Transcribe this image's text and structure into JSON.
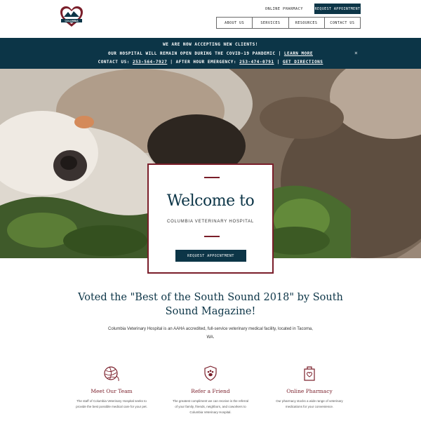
{
  "header": {
    "logo_text": "COLUMBIA",
    "pharmacy_link": "ONLINE PHARMACY",
    "appointment_button": "REQUEST APPOINTMENT",
    "nav": [
      "ABOUT US",
      "SERVICES",
      "RESOURCES",
      "CONTACT US"
    ]
  },
  "banner": {
    "line1": "WE ARE NOW ACCEPTING NEW CLIENTS!",
    "line2_text": "OUR HOSPITAL WILL REMAIN OPEN DURING THE COVID-19 PANDEMIC | ",
    "line2_link": "LEARN MORE",
    "contact_prefix": "CONTACT US: ",
    "contact_phone": "253-564-7927",
    "after_hours_prefix": " | AFTER HOUR EMERGENCY: ",
    "emergency_phone": "253-474-0791",
    "sep": " | ",
    "directions_link": "GET DIRECTIONS",
    "close_icon": "×"
  },
  "hero": {
    "title": "Welcome to",
    "subtitle": "COLUMBIA VETERINARY HOSPITAL",
    "button": "REQUEST APPOINTMENT"
  },
  "main": {
    "voted_heading": "Voted the \"Best of the South Sound 2018\" by South Sound Magazine!",
    "about_text": "Columbia Veterinary Hospital is an AAHA accredited, full-service veterinary medical facility, located in Tacoma, WA."
  },
  "features": [
    {
      "icon": "yarn-ball-icon",
      "title": "Meet Our Team",
      "desc": "The staff of Columbia Veterinary Hospital seeks to provide the best possible medical care for your pet."
    },
    {
      "icon": "paw-heart-icon",
      "title": "Refer a Friend",
      "desc": "The greatest compliment we can receive is the referral of your family, friends, neighbors, and coworkers to Columbia Veterinary Hospital."
    },
    {
      "icon": "pharmacy-bag-icon",
      "title": "Online Pharmacy",
      "desc": "Our pharmacy stocks a wide range of veterinary medications for your convenience."
    }
  ],
  "colors": {
    "navy": "#0c3547",
    "maroon": "#7a1e2a"
  }
}
